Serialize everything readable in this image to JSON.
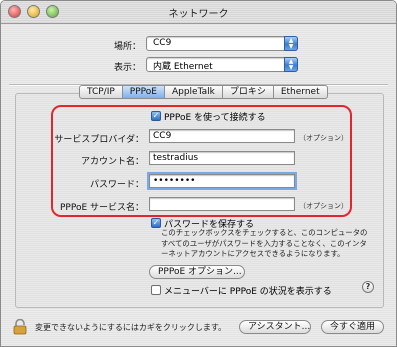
{
  "window": {
    "title": "ネットワーク"
  },
  "location": {
    "label": "場所：",
    "value": "CC9"
  },
  "show": {
    "label": "表示：",
    "value": "内蔵 Ethernet"
  },
  "tabs": [
    {
      "label": "TCP/IP"
    },
    {
      "label": "PPPoE"
    },
    {
      "label": "AppleTalk"
    },
    {
      "label": "プロキシ"
    },
    {
      "label": "Ethernet"
    }
  ],
  "pppoe": {
    "use_label": "PPPoE を使って接続する",
    "provider_label": "サービスプロバイダ：",
    "provider_value": "CC9",
    "provider_note": "（オプション）",
    "account_label": "アカウント名：",
    "account_value": "testradius",
    "password_label": "パスワード：",
    "password_value": "••••••••",
    "service_label": "PPPoE サービス名：",
    "service_value": "",
    "service_note": "（オプション）",
    "save_password_label": "パスワードを保存する",
    "save_password_desc": "このチェックボックスをチェックすると、このコンピュータのすべてのユーザがパスワードを入力することなく、このインターネットアカウントにアクセスできるようになります。",
    "options_button": "PPPoE オプション...",
    "menubar_label": "メニューバーに PPPoE の状況を表示する",
    "help_label": "?"
  },
  "footer": {
    "lock_text": "変更できないようにするにはカギをクリックします。",
    "assistant_button": "アシスタント...",
    "apply_button": "今すぐ適用"
  },
  "colors": {
    "highlight": "#e4252c",
    "accent": "#3b7bd0"
  }
}
